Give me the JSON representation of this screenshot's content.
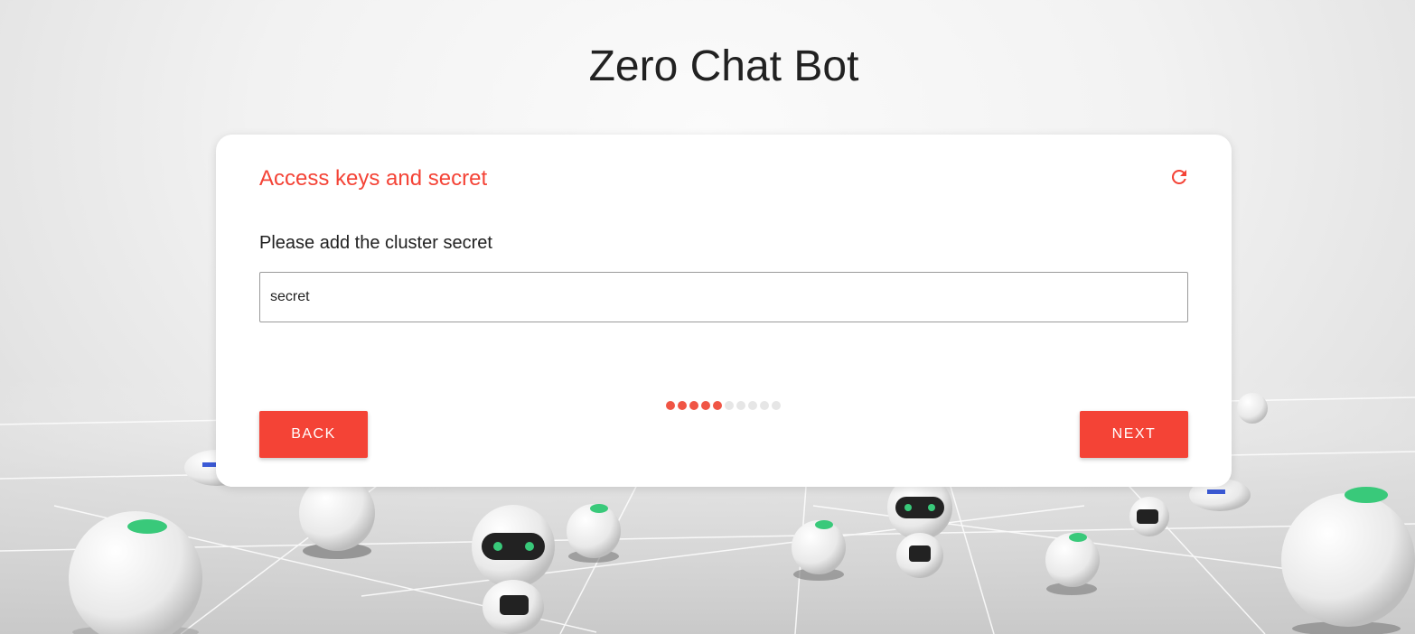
{
  "page": {
    "title": "Zero Chat Bot"
  },
  "step": {
    "title": "Access keys and secret",
    "refresh_icon": "refresh-icon",
    "field_label": "Please add the cluster secret",
    "input_value": "secret",
    "input_placeholder": "",
    "progress": {
      "total": 10,
      "completed": 5
    }
  },
  "buttons": {
    "back_label": "BACK",
    "next_label": "NEXT"
  },
  "colors": {
    "accent": "#f44336",
    "dot_active": "#f05545",
    "dot_inactive": "#e6e6e6",
    "title_text": "#212121"
  }
}
